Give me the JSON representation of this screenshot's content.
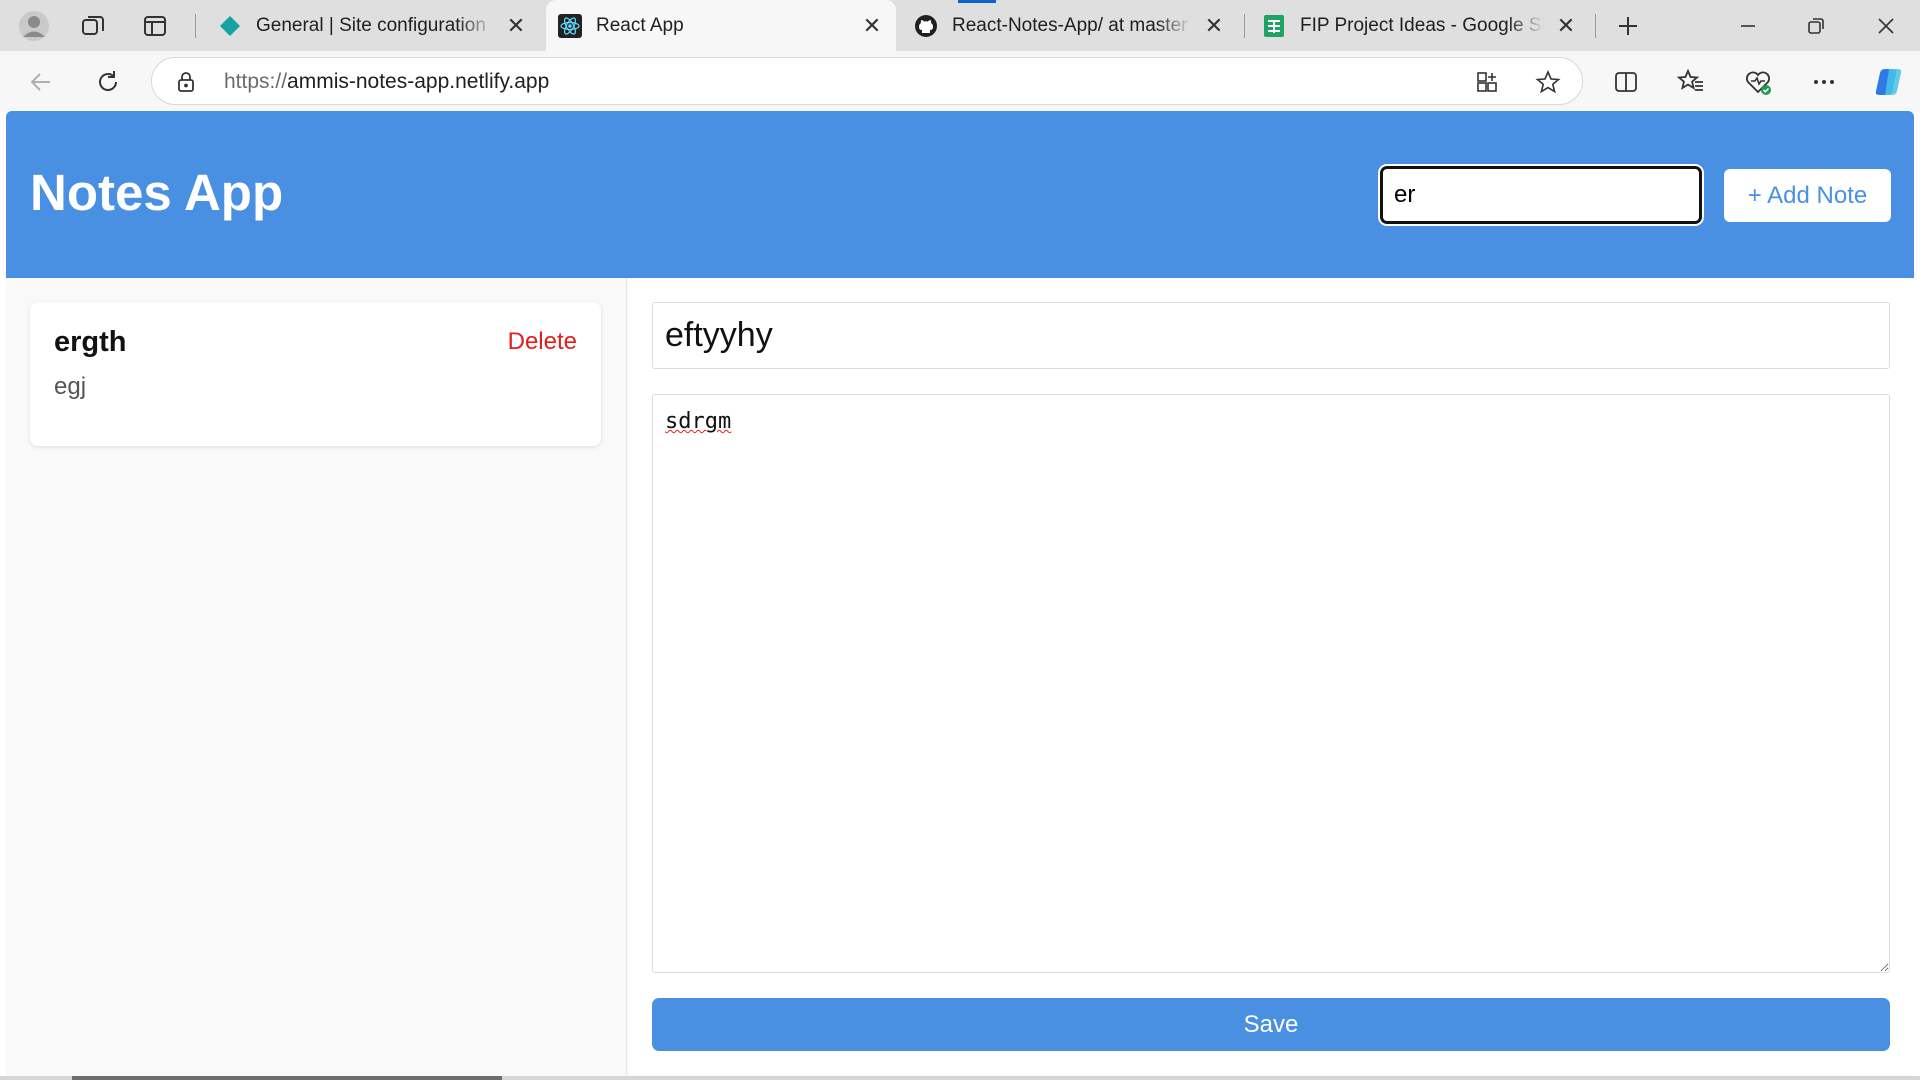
{
  "browser": {
    "tabs": [
      {
        "title": "General | Site configuration | ammis-notes-app",
        "favicon": "netlify-icon",
        "active": false
      },
      {
        "title": "React App",
        "favicon": "react-icon",
        "active": true
      },
      {
        "title": "React-Notes-App/ at master · Ammi",
        "favicon": "github-icon",
        "active": false
      },
      {
        "title": "FIP Project Ideas - Google Sheets",
        "favicon": "sheets-icon",
        "active": false
      }
    ],
    "address": {
      "scheme": "https://",
      "host": "ammis-notes-app.netlify.app"
    }
  },
  "colors": {
    "header": "#4a90e2",
    "accent": "#4a90e2",
    "delete": "#e0201c"
  },
  "app": {
    "title": "Notes App",
    "search": {
      "value": "er"
    },
    "add_note_label": "+ Add Note"
  },
  "notes": [
    {
      "title": "ergth",
      "body": "egj",
      "delete_label": "Delete"
    }
  ],
  "editor": {
    "title_value": "eftyyhy",
    "content_value": "sdrgm",
    "save_label": "Save"
  }
}
